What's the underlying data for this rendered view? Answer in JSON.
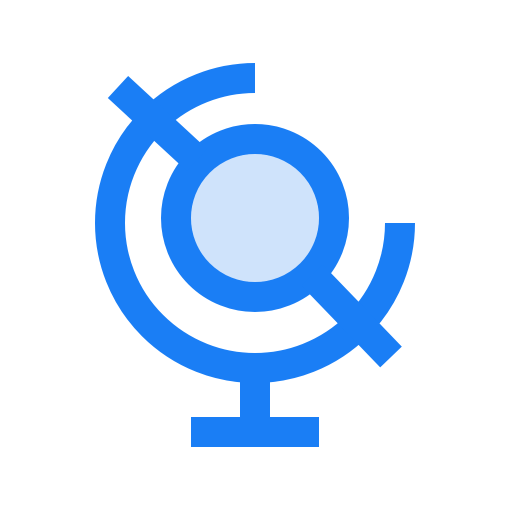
{
  "icon": {
    "name": "globe-icon",
    "colors": {
      "stroke": "#1a7ef5",
      "fill": "#cfe3fb",
      "background": "#ffffff"
    }
  }
}
